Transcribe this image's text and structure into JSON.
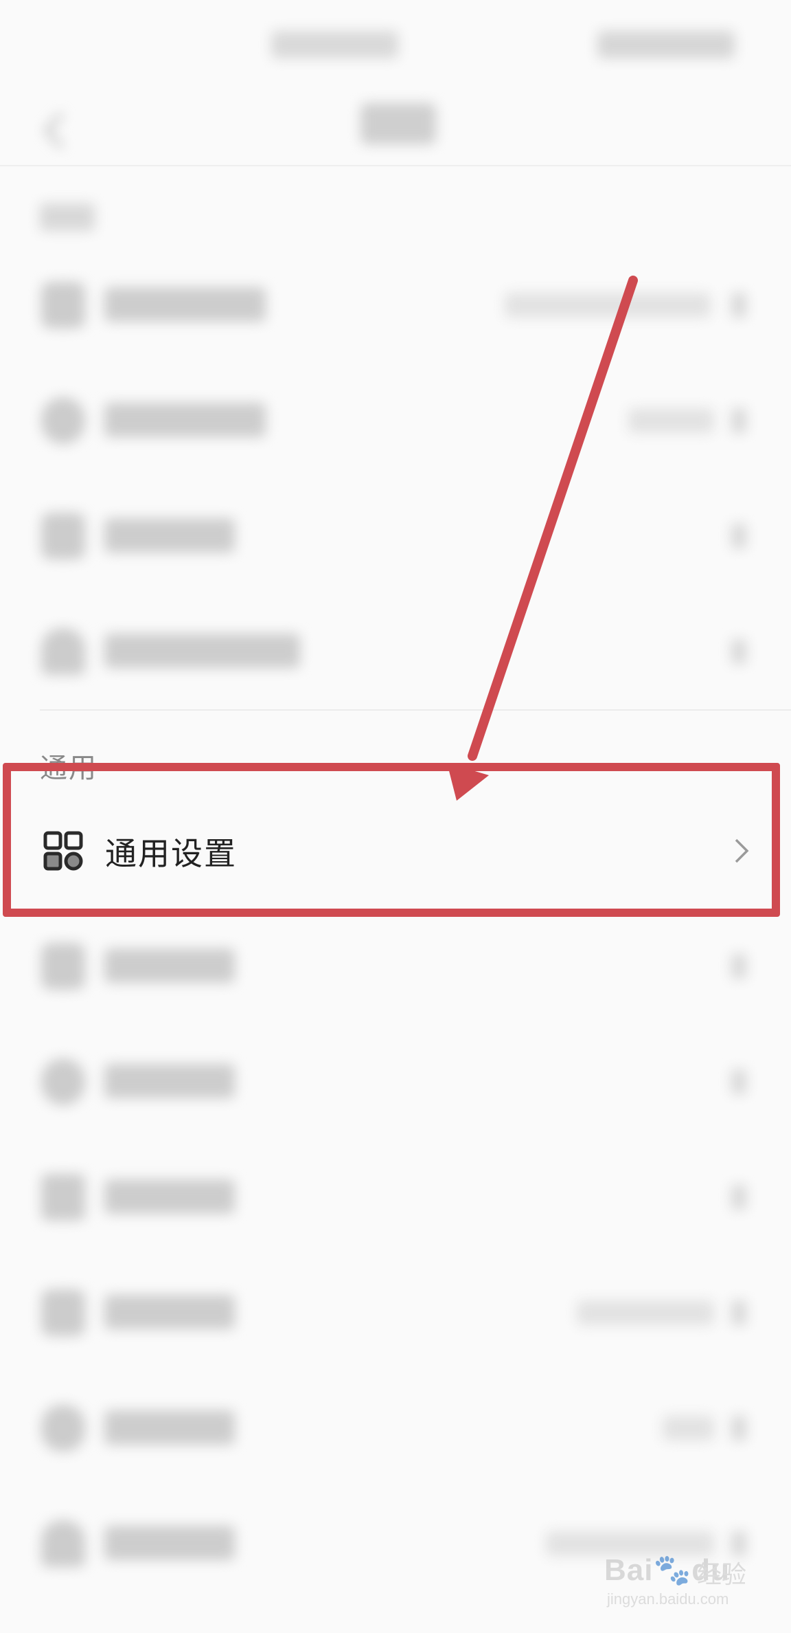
{
  "section": {
    "general_label": "通用"
  },
  "general_settings": {
    "label": "通用设置",
    "icon": "apps-grid-icon",
    "chevron": "chevron-right-icon"
  },
  "annotation": {
    "color": "#cf4a50"
  },
  "watermark": {
    "brand": "Bai",
    "brand_suffix": "du",
    "cn": "经验",
    "url": "jingyan.baidu.com"
  }
}
